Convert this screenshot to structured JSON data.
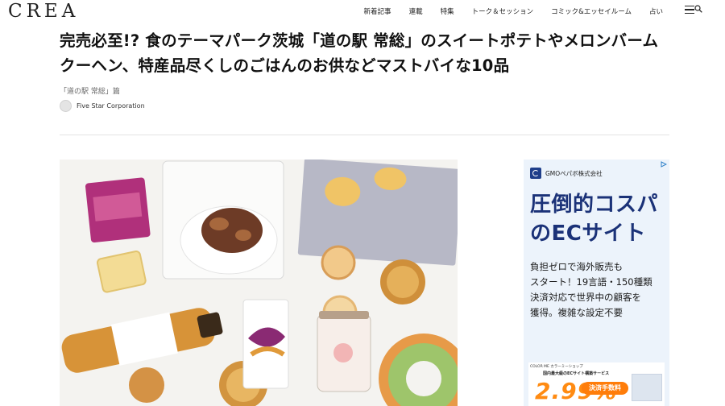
{
  "site": {
    "logo": "CREA"
  },
  "nav": {
    "items": [
      {
        "label": "新着記事"
      },
      {
        "label": "連載"
      },
      {
        "label": "特集"
      },
      {
        "label": "トーク＆セッション"
      },
      {
        "label": "コミック&エッセイルーム"
      },
      {
        "label": "占い"
      }
    ]
  },
  "article": {
    "title": "完売必至!? 食のテーマパーク茨城「道の駅 常総」のスイートポテトやメロンバームクーヘン、特産品尽くしのごはんのお供などマストバイな10品",
    "series": "「道の駅 常総」篇",
    "author": "Five Star Corporation"
  },
  "ad": {
    "brand": "GMOペパボ株式会社",
    "headline_line1": "圧倒的コスパ",
    "headline_line2": "のECサイト",
    "body_line1": "負担ゼロで海外販売も",
    "body_line2": "スタート！19言語・150種類",
    "body_line3": "決済対応で世界中の顧客を",
    "body_line4": "獲得。複雑な設定不要",
    "banner_top": "COLOR ME カラーミーショップ",
    "banner_sub": "国内最大級のECサイト構築サービス",
    "banner_pct": "2.99%",
    "banner_fee": "決済手数料"
  },
  "colors": {
    "ad_headline": "#1b3278",
    "ad_background": "#ecf3fb",
    "banner_accent": "#ff8b12"
  }
}
